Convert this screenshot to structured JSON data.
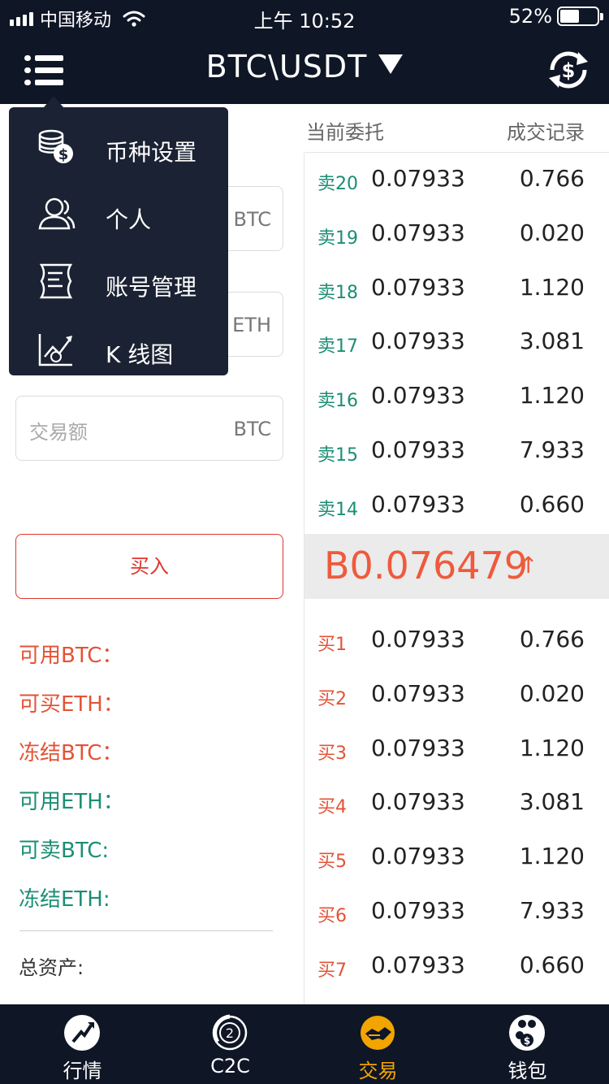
{
  "status_bar": {
    "carrier": "中国移动",
    "time": "上午 10:52",
    "battery": "52%",
    "battery_level": 0.52
  },
  "header": {
    "pair": "BTC\\USDT",
    "menu_icon": "list-menu-icon",
    "exchange_icon": "currency-exchange-icon",
    "bg_color": "#0f1626"
  },
  "tabs": {
    "current_orders": "当前委托",
    "trade_history": "成交记录"
  },
  "form": {
    "field1_unit": "BTC",
    "field2_unit": "ETH",
    "amount_placeholder": "交易额",
    "amount_unit": "BTC",
    "buy_button": "买入"
  },
  "balances": {
    "available_btc": "可用BTC：",
    "buyable_eth": "可买ETH：",
    "frozen_btc": "冻结BTC：",
    "available_eth": "可用ETH：",
    "sellable_btc": "可卖BTC:",
    "frozen_eth": "冻结ETH:",
    "total_assets": "总资产:"
  },
  "order_book": {
    "sells": [
      {
        "label": "卖20",
        "price": "0.07933",
        "amount": "0.766"
      },
      {
        "label": "卖19",
        "price": "0.07933",
        "amount": "0.020"
      },
      {
        "label": "卖18",
        "price": "0.07933",
        "amount": "1.120"
      },
      {
        "label": "卖17",
        "price": "0.07933",
        "amount": "3.081"
      },
      {
        "label": "卖16",
        "price": "0.07933",
        "amount": "1.120"
      },
      {
        "label": "卖15",
        "price": "0.07933",
        "amount": "7.933"
      },
      {
        "label": "卖14",
        "price": "0.07933",
        "amount": "0.660"
      }
    ],
    "last_price": "B0.076479",
    "last_arrow": "↑",
    "buys": [
      {
        "label": "买1",
        "price": "0.07933",
        "amount": "0.766"
      },
      {
        "label": "买2",
        "price": "0.07933",
        "amount": "0.020"
      },
      {
        "label": "买3",
        "price": "0.07933",
        "amount": "1.120"
      },
      {
        "label": "买4",
        "price": "0.07933",
        "amount": "3.081"
      },
      {
        "label": "买5",
        "price": "0.07933",
        "amount": "1.120"
      },
      {
        "label": "买6",
        "price": "0.07933",
        "amount": "7.933"
      },
      {
        "label": "买7",
        "price": "0.07933",
        "amount": "0.660"
      }
    ],
    "sell_color": "#1b8e74",
    "buy_color": "#e35336"
  },
  "dropdown_menu": {
    "items": [
      {
        "label": "币种设置",
        "icon": "coins-icon"
      },
      {
        "label": "个人",
        "icon": "users-icon"
      },
      {
        "label": "账号管理",
        "icon": "account-scroll-icon"
      },
      {
        "label": "K 线图",
        "icon": "kline-chart-icon"
      }
    ]
  },
  "bottom_nav": {
    "items": [
      {
        "label": "行情",
        "icon": "market-trend-icon"
      },
      {
        "label": "C2C",
        "icon": "c2c-icon"
      },
      {
        "label": "交易",
        "icon": "trade-handshake-icon",
        "active": true
      },
      {
        "label": "钱包",
        "icon": "wallet-icon"
      }
    ],
    "active_color": "#f2a400"
  }
}
